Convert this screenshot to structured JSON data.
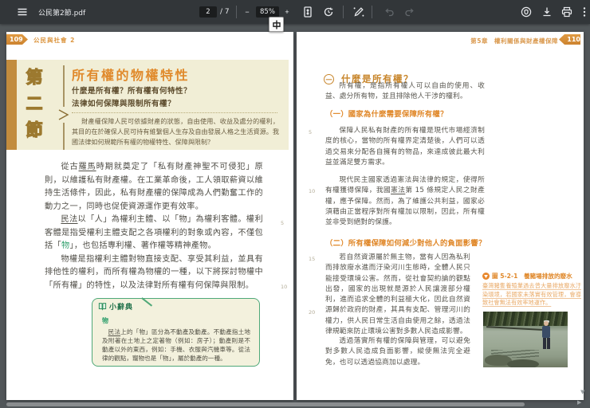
{
  "toolbar": {
    "filename": "公民第2節.pdf",
    "page_value": "2",
    "page_total": "/ 7",
    "zoom_out_label": "−",
    "zoom_value": "85%",
    "zoom_in_label": "+"
  },
  "left_page": {
    "page_number": "109",
    "book_title": "公民與社會 2",
    "section": {
      "chars": [
        "第",
        "二",
        "節"
      ],
      "title": "所有權的物權特性",
      "q1": "什麼是所有權？所有權有何特性？",
      "q2": "法律如何保障與限制所有權？",
      "intro": "財產權保障人民可依據財產的狀態，自由使用、收益及處分的權利，其目的在於確保人民可持有維繫個人生存及自由發展人格之生活資源。我國法律如何規範所有權的物權特性、保障與限制？"
    },
    "paragraphs": [
      {
        "segments": [
          {
            "t": "從古"
          },
          {
            "t": "羅馬",
            "c": "u"
          },
          {
            "t": "時期就奠定了「私有財產神聖不可侵犯」原則，以維護私有財產權。在工業革命後，工人領取薪資以維持生活條件，因此，私有財產權的保障成為人們勤奮工作的動力之一，同時也促使資源運作更有效率。"
          }
        ]
      },
      {
        "segments": [
          {
            "t": "民法",
            "c": "u"
          },
          {
            "t": "以「人」為權利主體、以「物」為權利客體。權利客體是指受權利主體支配之各項權利的對象或內容，不僅包括「"
          },
          {
            "t": "物",
            "c": "g"
          },
          {
            "t": "」，也包括專利權、著作權等精神產物。"
          }
        ]
      },
      {
        "segments": [
          {
            "t": "物權是指權利主體對物直接支配、享受其利益，並具有排他性的權利，而所有權為物權的一種，以下將探討物權中「所有權」的特性，以及法律對所有權有何保障與限制。"
          }
        ]
      }
    ],
    "line_numbers": [
      "5",
      "10"
    ],
    "dictionary": {
      "label": "小辭典",
      "term": "物",
      "body_segments": [
        {
          "t": "民法",
          "c": "u"
        },
        {
          "t": "上的「物」區分為不動產及動產。不動產指土地及附著在土地上之定著物（例如：房子）；動產則是不動產以外的東西，例如：手機、衣服與汽機車等。從法律的觀點，寵物也是「物」，屬於動產的一種。"
        }
      ]
    }
  },
  "right_page": {
    "page_number": "110",
    "chapter_header": "第5章　權利關係與財產權保障",
    "section_number": "一",
    "section_title": "什麼是所有權？",
    "p1": "所有權，是指所有權人可以自由的使用、收益、處分所有物，並且排除他人干涉的權利。",
    "sub1": "（一）國家為什麼需要保障所有權？",
    "p2": "保障人民私有財產的所有權是現代市場經濟制度的核心，當物的所有權界定清楚後，人們可以透過交易來分配各自擁有的物品，來達成彼此最大利益並滿足雙方需求。",
    "p3_segments": [
      {
        "t": "現代民主國家透過憲法與法律的規定，使得所有權獲得保障，我國"
      },
      {
        "t": "憲法",
        "c": "u"
      },
      {
        "t": "第 15 條規定人民之財產權，應予保障。然而，為了維護公共利益，國家必須藉由正當程序對所有權加以限制，因此，所有權並非受到絕對的保護。"
      }
    ],
    "sub2": "（二）所有權保障如何減少對他人的負面影響？",
    "p4": "若自然資源屬於無主物，當有人因為私利而排放廢水進而汙染河川生態時，全體人民只能接受環境公害。然而，從社會契約論的觀點出發，國家的出現就是源於人民讓渡部分權利，進而追求全體的利益極大化，因此自然資源歸於政府的財產，其具有支配、管理河川的權力，供人民日常生活自由使用之餘，透過法律規範來防止環境公害對多數人民造成影響。",
    "p5": "透過落實所有權的保障與管理，可以避免對多數人民造成負面影響，縱使無法完全避免，也可以透過協商加以處理。",
    "line_numbers": [
      "5",
      "10",
      "15",
      "20"
    ],
    "figure": {
      "caption": "圖 5-2-1　養豬場排放的廢水",
      "note": "臺灣豬隻養殖業過去曾大量排放廢水汙染環境，若國家未落實有效管理，會導致社會無法有效率地運作。"
    }
  },
  "colors": {
    "accent_orange": "#e08a2c",
    "band_gold": "#c28c3e",
    "green": "#2e9e6b",
    "toolbar_bg": "#323639"
  }
}
